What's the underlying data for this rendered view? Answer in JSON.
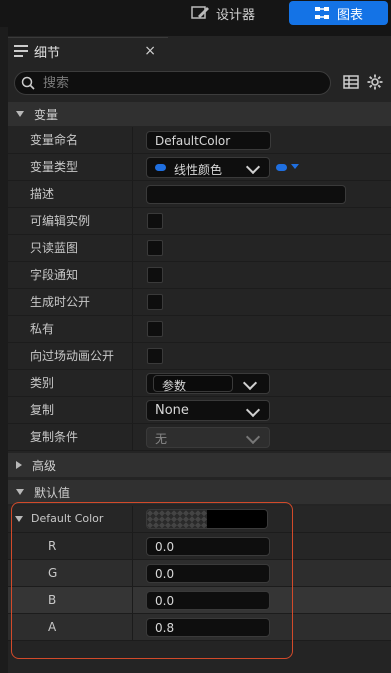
{
  "top_tabs": {
    "designer": "设计器",
    "graph": "图表"
  },
  "panel": {
    "title": "细节",
    "close": "×"
  },
  "search": {
    "placeholder": "搜索"
  },
  "sections": {
    "variables": "变量",
    "advanced": "高级",
    "default_value": "默认值"
  },
  "rows": {
    "var_name": {
      "label": "变量命名",
      "value": "DefaultColor"
    },
    "var_type": {
      "label": "变量类型",
      "value": "线性颜色"
    },
    "description": {
      "label": "描述",
      "value": ""
    },
    "instance_editable": {
      "label": "可编辑实例"
    },
    "read_only": {
      "label": "只读蓝图"
    },
    "field_notify": {
      "label": "字段通知"
    },
    "expose_on_spawn": {
      "label": "生成时公开"
    },
    "private": {
      "label": "私有"
    },
    "expose_cinematics": {
      "label": "向过场动画公开"
    },
    "category": {
      "label": "类别",
      "value": "参数"
    },
    "replication": {
      "label": "复制",
      "value": "None"
    },
    "replication_condition": {
      "label": "复制条件",
      "value": "无"
    }
  },
  "default_color": {
    "label": "Default Color",
    "channels": [
      {
        "name": "R",
        "value": "0.0"
      },
      {
        "name": "G",
        "value": "0.0"
      },
      {
        "name": "B",
        "value": "0.0"
      },
      {
        "name": "A",
        "value": "0.8"
      }
    ]
  },
  "colors": {
    "accent": "#1473e6",
    "highlight_border": "#d24a2a",
    "pin_blue": "#1f6fe0"
  },
  "icons": [
    "designer-icon",
    "graph-icon",
    "details-icon",
    "close-icon",
    "search-icon",
    "table-view-icon",
    "settings-icon",
    "chevron-down-icon"
  ]
}
